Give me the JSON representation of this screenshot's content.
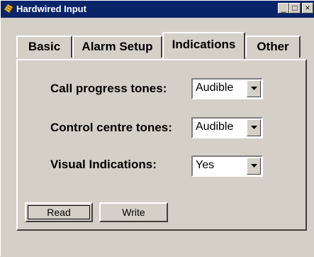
{
  "window": {
    "title": "Hardwired Input",
    "minimize_label": "_",
    "maximize_label": "□",
    "close_label": "×"
  },
  "tabs": [
    {
      "label": "Basic"
    },
    {
      "label": "Alarm Setup"
    },
    {
      "label": "Indications"
    },
    {
      "label": "Other"
    }
  ],
  "active_tab": "Indications",
  "settings": [
    {
      "label": "Call progress tones:",
      "value": "Audible"
    },
    {
      "label": "Control centre tones:",
      "value": "Audible"
    },
    {
      "label": "Visual Indications:",
      "value": "Yes"
    }
  ],
  "buttons": {
    "read_label": "Read",
    "write_label": "Write"
  },
  "colors": {
    "titlebar": "#0a246a",
    "face": "#d4d0c8"
  }
}
